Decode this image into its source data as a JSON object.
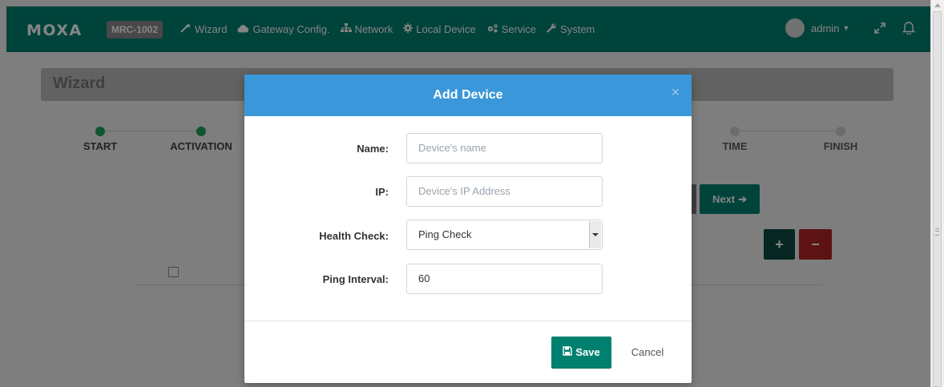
{
  "topbar": {
    "logo": "MOXA",
    "model": "MRC-1002",
    "nav": [
      {
        "label": "Wizard",
        "icon": "wand-icon"
      },
      {
        "label": "Gateway Config.",
        "icon": "cloud-icon"
      },
      {
        "label": "Network",
        "icon": "sitemap-icon"
      },
      {
        "label": "Local Device",
        "icon": "gear-icon"
      },
      {
        "label": "Service",
        "icon": "gears-icon"
      },
      {
        "label": "System",
        "icon": "wrench-icon"
      }
    ],
    "user": "admin"
  },
  "page": {
    "title": "Wizard",
    "steps": [
      {
        "label": "START",
        "state": "done"
      },
      {
        "label": "ACTIVATION",
        "state": "done"
      },
      {
        "label": "TIME",
        "state": "pending"
      },
      {
        "label": "FINISH",
        "state": "pending"
      }
    ],
    "next_label": "Next",
    "add_label": "+",
    "remove_label": "−"
  },
  "modal": {
    "title": "Add Device",
    "fields": {
      "name_label": "Name:",
      "name_placeholder": "Device's name",
      "ip_label": "IP:",
      "ip_placeholder": "Device's IP Address",
      "health_label": "Health Check:",
      "health_value": "Ping Check",
      "interval_label": "Ping Interval:",
      "interval_value": "60"
    },
    "save_label": "Save",
    "cancel_label": "Cancel"
  },
  "colors": {
    "topbar": "#00806f",
    "modal_header": "#3a97d9",
    "remove": "#b32625",
    "add": "#0b4a40"
  }
}
